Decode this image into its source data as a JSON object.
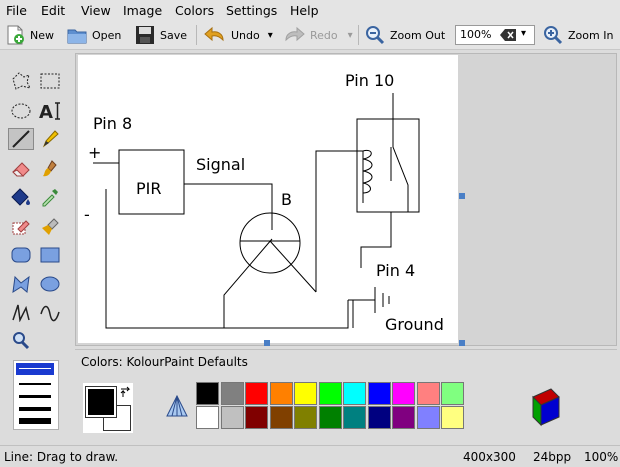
{
  "menu": {
    "file": "File",
    "edit": "Edit",
    "view": "View",
    "image": "Image",
    "colors": "Colors",
    "settings": "Settings",
    "help": "Help"
  },
  "toolbar": {
    "new": "New",
    "open": "Open",
    "save": "Save",
    "undo": "Undo",
    "redo": "Redo",
    "zoom_out": "Zoom Out",
    "zoom_value": "100%",
    "zoom_in": "Zoom In"
  },
  "drawing": {
    "pin8": "Pin 8",
    "plus": "+",
    "minus": "-",
    "pir": "PIR",
    "signal": "Signal",
    "b": "B",
    "pin10": "Pin 10",
    "pin4": "Pin 4",
    "ground": "Ground"
  },
  "colors_panel": {
    "label_prefix": "Colors: ",
    "label_name": "KolourPaint Defaults",
    "palette_top": [
      "#000000",
      "#808080",
      "#ff0000",
      "#ff8000",
      "#ffff00",
      "#00ff00",
      "#00ffff",
      "#0000ff",
      "#ff00ff",
      "#ff8080",
      "#80ff80"
    ],
    "palette_bottom": [
      "#ffffff",
      "#c0c0c0",
      "#800000",
      "#804000",
      "#808000",
      "#008000",
      "#008080",
      "#000080",
      "#800080",
      "#8080ff",
      "#ffff80"
    ],
    "foreground": "#000000",
    "background": "#ffffff"
  },
  "status": {
    "message": "Line: Drag to draw.",
    "size": "400x300",
    "depth": "24bpp",
    "zoom": "100%"
  }
}
